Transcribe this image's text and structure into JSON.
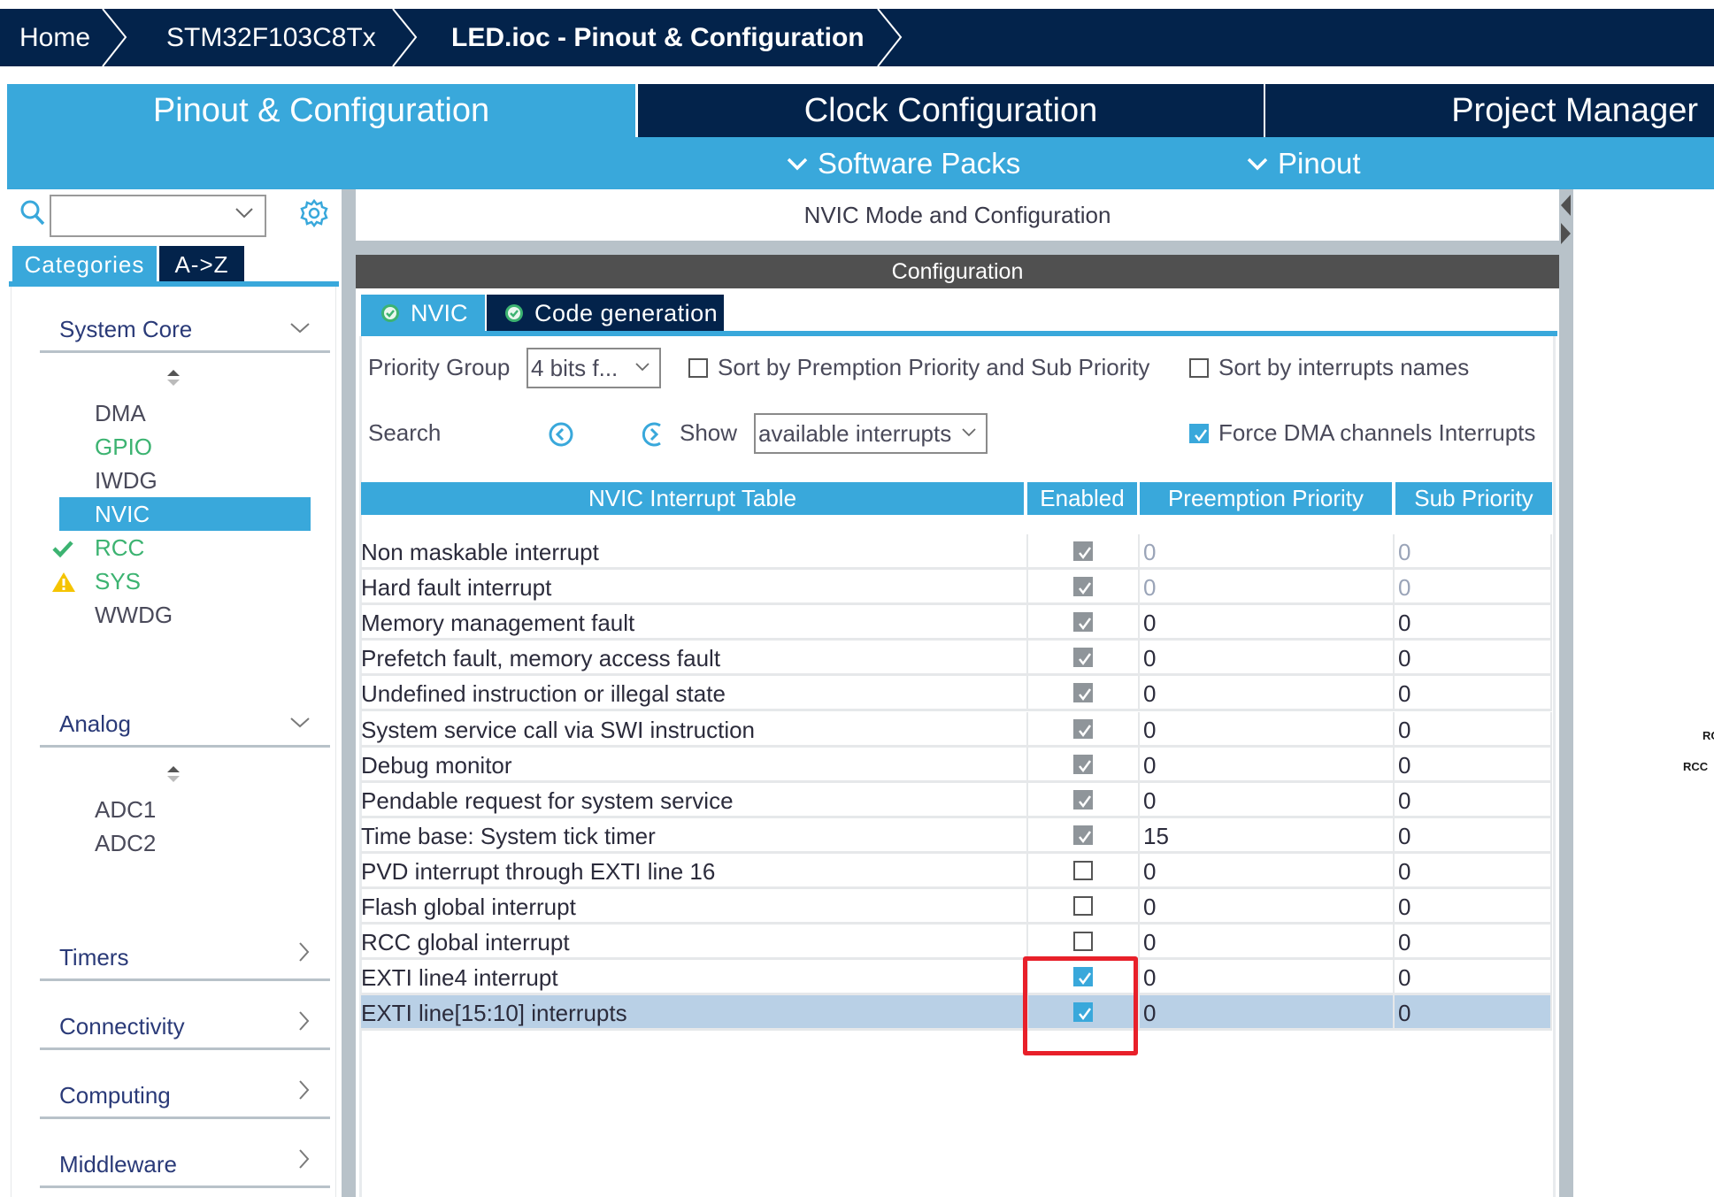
{
  "breadcrumb": {
    "items": [
      "Home",
      "STM32F103C8Tx",
      "LED.ioc - Pinout & Configuration"
    ]
  },
  "main_tabs": {
    "pinout": "Pinout & Configuration",
    "clock": "Clock Configuration",
    "project": "Project Manager",
    "active": "Pinout & Configuration"
  },
  "subbar": {
    "software_packs": "Software Packs",
    "pinout": "Pinout"
  },
  "left_panel": {
    "search": {
      "value": "",
      "placeholder": ""
    },
    "tabs": {
      "categories": "Categories",
      "az": "A->Z",
      "active": "Categories"
    },
    "categories": [
      {
        "label": "System Core",
        "expanded": true,
        "icon": "chevron-down-icon",
        "items": [
          {
            "label": "DMA",
            "status": "none"
          },
          {
            "label": "GPIO",
            "status": "configured"
          },
          {
            "label": "IWDG",
            "status": "none"
          },
          {
            "label": "NVIC",
            "status": "selected"
          },
          {
            "label": "RCC",
            "status": "ok"
          },
          {
            "label": "SYS",
            "status": "warning"
          },
          {
            "label": "WWDG",
            "status": "none"
          }
        ]
      },
      {
        "label": "Analog",
        "expanded": true,
        "icon": "chevron-down-icon",
        "items": [
          {
            "label": "ADC1",
            "status": "none"
          },
          {
            "label": "ADC2",
            "status": "none"
          }
        ]
      },
      {
        "label": "Timers",
        "expanded": false,
        "icon": "chevron-right-icon"
      },
      {
        "label": "Connectivity",
        "expanded": false,
        "icon": "chevron-right-icon"
      },
      {
        "label": "Computing",
        "expanded": false,
        "icon": "chevron-right-icon"
      },
      {
        "label": "Middleware",
        "expanded": false,
        "icon": "chevron-right-icon"
      }
    ]
  },
  "center": {
    "mode_title": "NVIC Mode and Configuration",
    "config_title": "Configuration",
    "tabs": [
      {
        "label": "NVIC",
        "active": true,
        "status": "ok"
      },
      {
        "label": "Code generation",
        "active": false,
        "status": "ok"
      }
    ],
    "priority_group": {
      "label": "Priority Group",
      "value": "4 bits f..."
    },
    "sort_premption": {
      "label": "Sort by Premption Priority and Sub Priority",
      "checked": false
    },
    "sort_names": {
      "label": "Sort by interrupts names",
      "checked": false
    },
    "search": {
      "label": "Search"
    },
    "show": {
      "label": "Show",
      "value": "available interrupts"
    },
    "force_dma": {
      "label": "Force DMA channels Interrupts",
      "checked": true
    },
    "table": {
      "headers": [
        "NVIC Interrupt Table",
        "Enabled",
        "Preemption Priority",
        "Sub Priority"
      ],
      "rows": [
        {
          "name": "Non maskable interrupt",
          "enabled": true,
          "locked": true,
          "preemption": "0",
          "sub": "0",
          "dim": true
        },
        {
          "name": "Hard fault interrupt",
          "enabled": true,
          "locked": true,
          "preemption": "0",
          "sub": "0",
          "dim": true
        },
        {
          "name": "Memory management fault",
          "enabled": true,
          "locked": true,
          "preemption": "0",
          "sub": "0"
        },
        {
          "name": "Prefetch fault, memory access fault",
          "enabled": true,
          "locked": true,
          "preemption": "0",
          "sub": "0"
        },
        {
          "name": "Undefined instruction or illegal state",
          "enabled": true,
          "locked": true,
          "preemption": "0",
          "sub": "0"
        },
        {
          "name": "System service call via SWI instruction",
          "enabled": true,
          "locked": true,
          "preemption": "0",
          "sub": "0"
        },
        {
          "name": "Debug monitor",
          "enabled": true,
          "locked": true,
          "preemption": "0",
          "sub": "0"
        },
        {
          "name": "Pendable request for system service",
          "enabled": true,
          "locked": true,
          "preemption": "0",
          "sub": "0"
        },
        {
          "name": "Time base: System tick timer",
          "enabled": true,
          "locked": true,
          "preemption": "15",
          "sub": "0"
        },
        {
          "name": "PVD interrupt through EXTI line 16",
          "enabled": false,
          "locked": false,
          "preemption": "0",
          "sub": "0"
        },
        {
          "name": "Flash global interrupt",
          "enabled": false,
          "locked": false,
          "preemption": "0",
          "sub": "0"
        },
        {
          "name": "RCC global interrupt",
          "enabled": false,
          "locked": false,
          "preemption": "0",
          "sub": "0"
        },
        {
          "name": "EXTI line4 interrupt",
          "enabled": true,
          "locked": false,
          "preemption": "0",
          "sub": "0"
        },
        {
          "name": "EXTI line[15:10] interrupts",
          "enabled": true,
          "locked": false,
          "preemption": "0",
          "sub": "0",
          "selected": true
        }
      ]
    }
  },
  "right_area": {
    "pin_labels": [
      "RC",
      "RCC"
    ]
  },
  "annotation": {
    "highlight_color": "#e8202a"
  },
  "colors": {
    "navy": "#03234b",
    "accent_blue": "#39a8db",
    "config_bar": "#505050",
    "selected_row": "#b9d0e6",
    "ok_green": "#3cb371",
    "warning_yellow": "#f5c400"
  }
}
